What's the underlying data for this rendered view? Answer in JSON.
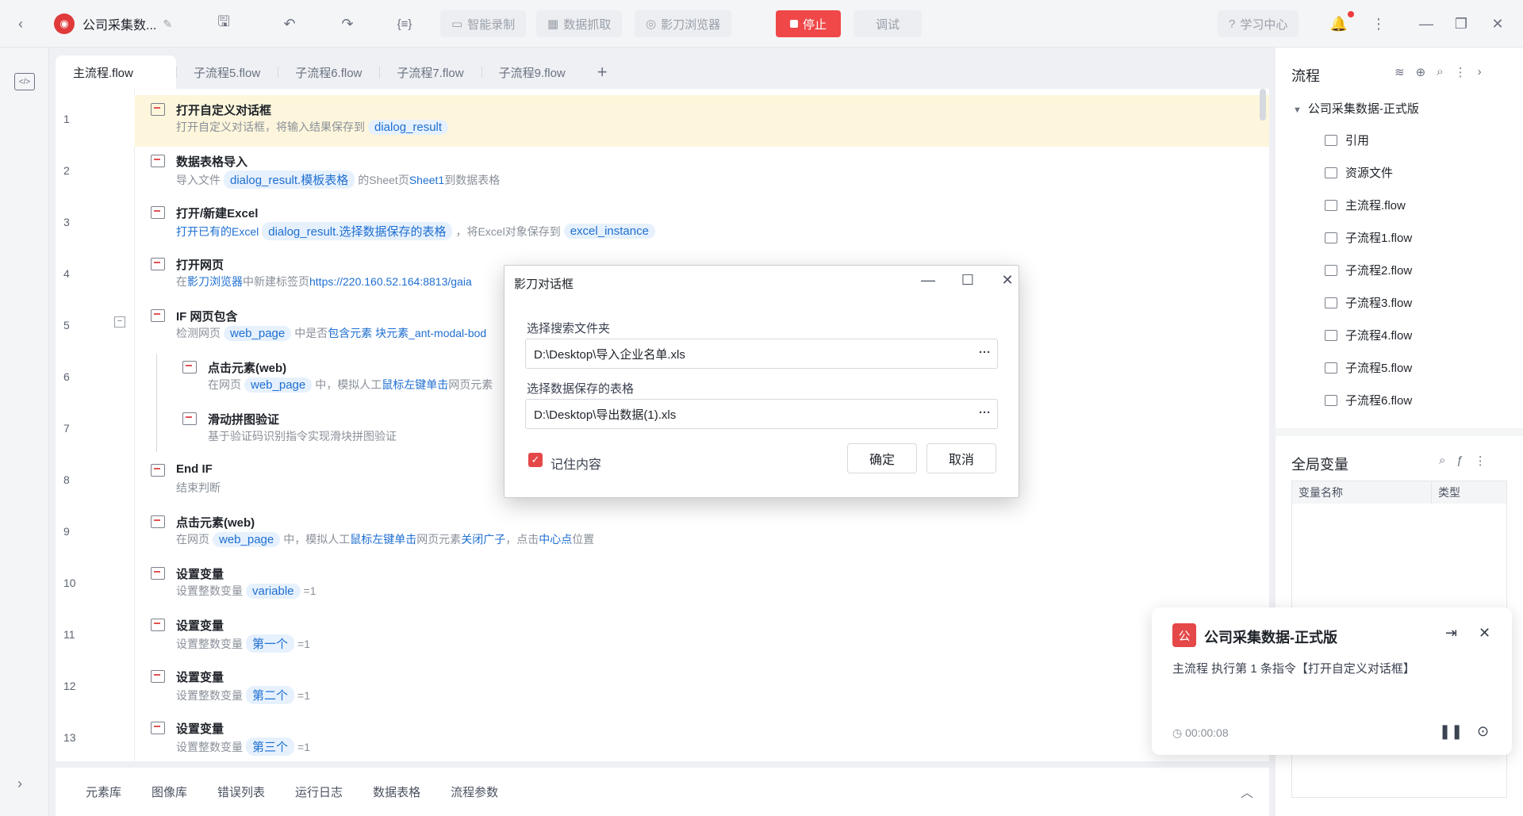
{
  "topbar": {
    "project_title": "公司采集数...",
    "smart_record": "智能录制",
    "data_capture": "数据抓取",
    "browser": "影刀浏览器",
    "stop": "停止",
    "debug": "调试",
    "learning_center": "学习中心"
  },
  "tabs": [
    "主流程.flow",
    "子流程5.flow",
    "子流程6.flow",
    "子流程7.flow",
    "子流程9.flow"
  ],
  "editor": {
    "rows": [
      {
        "no": "1",
        "title": "打开自定义对话框",
        "d1": "打开自定义对话框，将输入结果保存到",
        "c1": "dialog_result"
      },
      {
        "no": "2",
        "title": "数据表格导入",
        "d1": "导入文件",
        "c1": "dialog_result.模板表格",
        "d2": "的Sheet页",
        "b1": "Sheet1",
        "d3": "到数据表格"
      },
      {
        "no": "3",
        "title": "打开/新建Excel",
        "b0": "打开已有的Excel",
        "c1": "dialog_result.选择数据保存的表格",
        "d2": "，将Excel对象保存到",
        "c2": "excel_instance"
      },
      {
        "no": "4",
        "title": "打开网页",
        "d1": "在",
        "b1": "影刀浏览器",
        "d2": "中新建标签页",
        "b2": "https://220.160.52.164:8813/gaia"
      },
      {
        "no": "5",
        "title": "IF 网页包含",
        "d1": "检测网页",
        "c1": "web_page",
        "d2": "中是否",
        "b1": "包含元素 块元素_ant-modal-bod"
      },
      {
        "no": "6",
        "title": "点击元素(web)",
        "d1": "在网页",
        "c1": "web_page",
        "d2": "中，模拟人工",
        "b1": "鼠标左键单击",
        "d3": "网页元素"
      },
      {
        "no": "7",
        "title": "滑动拼图验证",
        "d1": "基于验证码识别指令实现滑块拼图验证"
      },
      {
        "no": "8",
        "title": "End IF",
        "d1": "结束判断"
      },
      {
        "no": "9",
        "title": "点击元素(web)",
        "d1": "在网页",
        "c1": "web_page",
        "d2": "中，模拟人工",
        "b1": "鼠标左键单击",
        "d3": "网页元素",
        "b2": "关闭广子",
        "d4": "，点击",
        "b3": "中心点",
        "d5": "位置"
      },
      {
        "no": "10",
        "title": "设置变量",
        "d1": "设置整数变量",
        "c1": "variable",
        "d2": "=1"
      },
      {
        "no": "11",
        "title": "设置变量",
        "d1": "设置整数变量",
        "c1": "第一个",
        "d2": "=1"
      },
      {
        "no": "12",
        "title": "设置变量",
        "d1": "设置整数变量",
        "c1": "第二个",
        "d2": "=1"
      },
      {
        "no": "13",
        "title": "设置变量",
        "d1": "设置整数变量",
        "c1": "第三个",
        "d2": "=1"
      }
    ]
  },
  "bottom_tabs": [
    "元素库",
    "图像库",
    "错误列表",
    "运行日志",
    "数据表格",
    "流程参数"
  ],
  "flow_panel": {
    "title": "流程",
    "root": "公司采集数据-正式版",
    "items": [
      "引用",
      "资源文件",
      "主流程.flow",
      "子流程1.flow",
      "子流程2.flow",
      "子流程3.flow",
      "子流程4.flow",
      "子流程5.flow",
      "子流程6.flow"
    ]
  },
  "globals": {
    "title": "全局变量",
    "col_name": "变量名称",
    "col_type": "类型"
  },
  "dialog": {
    "title": "影刀对话框",
    "label1": "选择搜索文件夹",
    "value1": "D:\\Desktop\\导入企业名单.xls",
    "label2": "选择数据保存的表格",
    "value2": "D:\\Desktop\\导出数据(1).xls",
    "remember": "记住内容",
    "ok": "确定",
    "cancel": "取消",
    "dots": "···"
  },
  "toast": {
    "logo": "公",
    "title": "公司采集数据-正式版",
    "message": "主流程 执行第 1 条指令【打开自定义对话框】",
    "time": "00:00:08"
  },
  "colors": {
    "accent_red": "#f04848",
    "link_blue": "#1f6fd1",
    "highlight_row": "#fdf6dc"
  }
}
